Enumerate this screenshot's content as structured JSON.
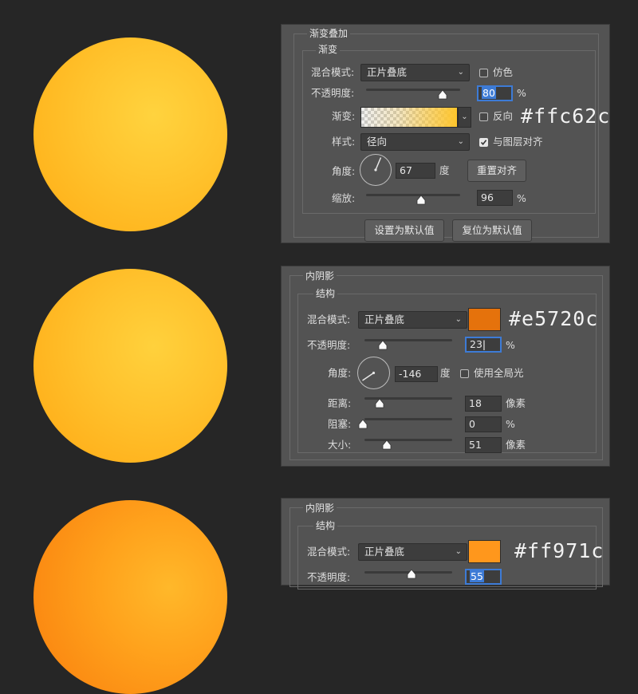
{
  "colors": {
    "background": "#262626",
    "panel": "#535353",
    "accent_focus": "#3d7bd6",
    "inner_shadow_1": "#e5720c",
    "inner_shadow_2": "#ff971c",
    "gradient_end": "#ffc62c"
  },
  "gradient_overlay": {
    "title": "渐变叠加",
    "group_title": "渐变",
    "blend_mode_label": "混合模式:",
    "blend_mode_value": "正片叠底",
    "dither_label": "仿色",
    "opacity_label": "不透明度:",
    "opacity_value": "80",
    "opacity_fraction": 0.8,
    "percent": "%",
    "gradient_label": "渐变:",
    "reverse_label": "反向",
    "hex_label": "#ffc62c",
    "style_label": "样式:",
    "style_value": "径向",
    "align_label": "与图层对齐",
    "align_checked": true,
    "angle_label": "角度:",
    "angle_value": "67",
    "degree_unit": "度",
    "reset_align_button": "重置对齐",
    "scale_label": "缩放:",
    "scale_value": "96",
    "scale_fraction": 0.45,
    "set_default_button": "设置为默认值",
    "reset_default_button": "复位为默认值",
    "icon_chevron": "chevron-down-icon"
  },
  "inner_shadow_1": {
    "title": "内阴影",
    "group_title": "结构",
    "blend_mode_label": "混合模式:",
    "blend_mode_value": "正片叠底",
    "hex_label": "#e5720c",
    "opacity_label": "不透明度:",
    "opacity_value": "23",
    "opacity_fraction": 0.23,
    "percent": "%",
    "angle_label": "角度:",
    "angle_value": "-146",
    "degree_unit": "度",
    "global_light_label": "使用全局光",
    "distance_label": "距离:",
    "distance_value": "18",
    "pixel_unit": "像素",
    "choke_label": "阻塞:",
    "choke_value": "0",
    "size_label": "大小:",
    "size_value": "51"
  },
  "inner_shadow_2": {
    "title": "内阴影",
    "group_title": "结构",
    "blend_mode_label": "混合模式:",
    "blend_mode_value": "正片叠底",
    "hex_label": "#ff971c",
    "opacity_label": "不透明度:",
    "opacity_value": "55"
  }
}
